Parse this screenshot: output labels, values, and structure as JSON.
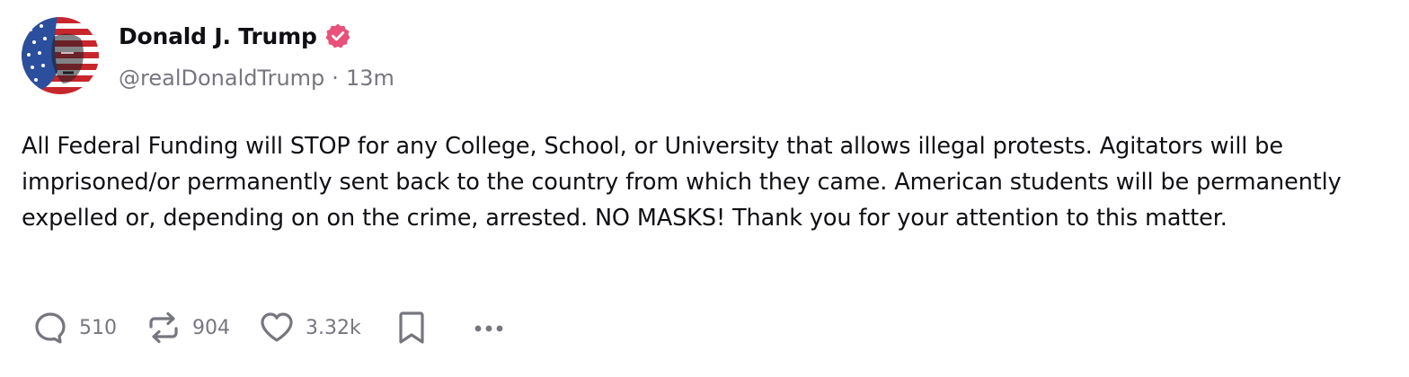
{
  "post": {
    "author": {
      "display_name": "Donald J. Trump",
      "handle": "@realDonaldTrump",
      "verified": true,
      "avatar_icon": "flag-portrait-avatar"
    },
    "separator": "·",
    "timestamp": "13m",
    "body": "All Federal Funding will STOP for any College, School, or University that allows illegal protests. Agitators will be imprisoned/or permanently sent back to the country from which they came. American students will be permanently expelled or, depending on on the crime, arrested. NO MASKS! Thank you for your attention to this matter.",
    "actions": {
      "replies": "510",
      "reposts": "904",
      "likes": "3.32k",
      "reply_icon": "reply-icon",
      "repost_icon": "repost-icon",
      "like_icon": "heart-icon",
      "bookmark_icon": "bookmark-icon",
      "more_icon": "more-icon"
    }
  },
  "colors": {
    "text_primary": "#0f0f14",
    "text_secondary": "#76767f",
    "verified_badge": "#e8517a",
    "icon": "#76767f"
  }
}
